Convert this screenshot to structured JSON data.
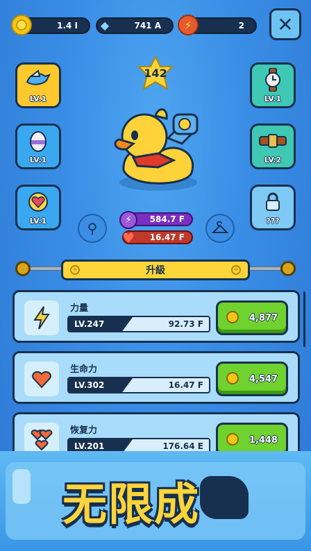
{
  "resources": {
    "coins": "1.4 I",
    "gems": "741 A",
    "energy": "2"
  },
  "level": "142",
  "slots": {
    "wing": "LV.1",
    "egg": "LV.1",
    "heart": "LV.1",
    "watch": "LV.1",
    "belt": "LV.2",
    "locked": "???"
  },
  "stats": {
    "power": "584.7 F",
    "health": "16.47 F"
  },
  "upgrade_tab": "升級",
  "cards": [
    {
      "name": "力量",
      "level": "LV.247",
      "value": "92.73 F",
      "price": "4,877"
    },
    {
      "name": "生命力",
      "level": "LV.302",
      "value": "16.47 F",
      "price": "4,547"
    },
    {
      "name": "恢复力",
      "level": "LV.201",
      "value": "176.64 E",
      "price": "1,448"
    }
  ],
  "banner_text": "无限成"
}
